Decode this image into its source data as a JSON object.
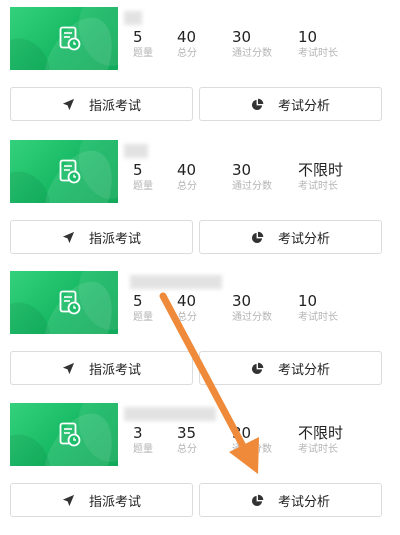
{
  "colors": {
    "accent_green": "#1ebd6c",
    "arrow_orange": "#ef8a3a"
  },
  "labels": {
    "questions": "题量",
    "total_score": "总分",
    "pass_score": "通过分数",
    "duration": "考试时长"
  },
  "buttons": {
    "assign": "指派考试",
    "analysis": "考试分析"
  },
  "icons": {
    "thumb": "exam-clock-icon",
    "assign": "send-icon",
    "analysis": "pie-chart-icon",
    "annotation": "orange-arrow"
  },
  "exams": [
    {
      "questions": "5",
      "total": "40",
      "pass": "30",
      "duration": "10"
    },
    {
      "questions": "5",
      "total": "40",
      "pass": "30",
      "duration": "不限时"
    },
    {
      "questions": "5",
      "total": "40",
      "pass": "30",
      "duration": "10"
    },
    {
      "questions": "3",
      "total": "35",
      "pass": "30",
      "duration": "不限时"
    }
  ]
}
